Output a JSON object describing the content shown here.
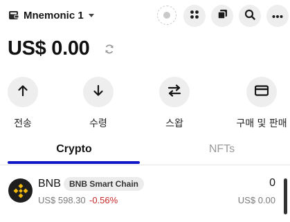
{
  "header": {
    "wallet_name": "Mnemonic 1",
    "icons": [
      "wallet-icon",
      "chevron-down-icon",
      "status-dot-icon",
      "apps-grid-icon",
      "copy-icon",
      "search-icon",
      "more-icon"
    ]
  },
  "balance": {
    "amount": "US$ 0.00"
  },
  "actions": [
    {
      "label": "전송",
      "icon": "arrow-up-icon"
    },
    {
      "label": "수령",
      "icon": "arrow-down-icon"
    },
    {
      "label": "스왑",
      "icon": "swap-icon"
    },
    {
      "label": "구매 및 판매",
      "icon": "card-icon"
    }
  ],
  "tabs": [
    {
      "label": "Crypto",
      "active": true
    },
    {
      "label": "NFTs",
      "active": false
    }
  ],
  "assets": [
    {
      "symbol": "BNB",
      "chain": "BNB Smart Chain",
      "price": "US$ 598.30",
      "change": "-0.56%",
      "amount": "0",
      "value": "US$ 0.00"
    }
  ],
  "colors": {
    "accent": "#1018c8",
    "negative": "#c62828",
    "bnb_yellow": "#f0b90b"
  }
}
